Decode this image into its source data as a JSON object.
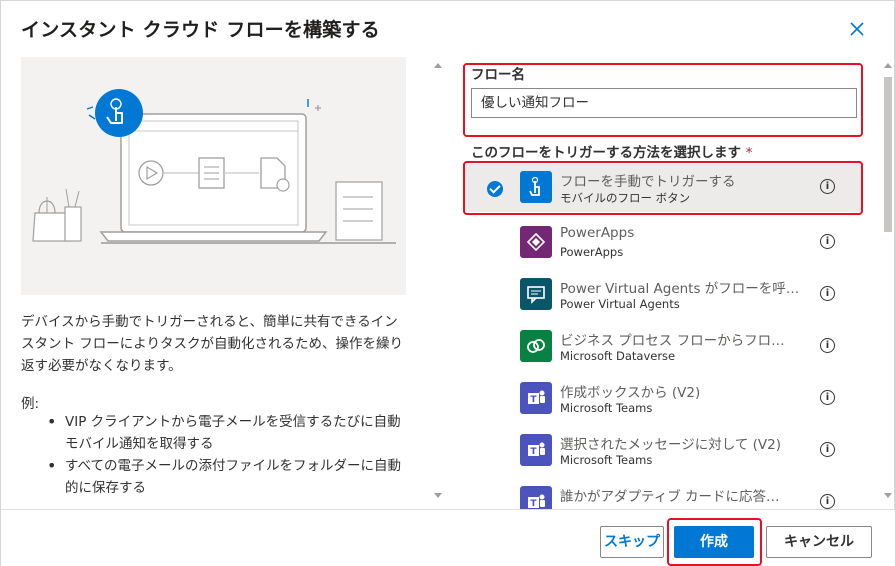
{
  "dialog": {
    "title": "インスタント クラウド フローを構築する",
    "close_icon": "close-icon"
  },
  "left": {
    "illustration_icon": "touch-icon",
    "description": "デバイスから手動でトリガーされると、簡単に共有できるインスタント フローによりタスクが自動化されるため、操作を繰り返す必要がなくなります。",
    "example_label": "例:",
    "examples": [
      "VIP クライアントから電子メールを受信するたびに自動モバイル通知を取得する",
      "すべての電子メールの添付ファイルをフォルダーに自動的に保存する"
    ]
  },
  "right": {
    "flow_name_label": "フロー名",
    "flow_name_value": "優しい通知フロー",
    "trigger_label": "このフローをトリガーする方法を選択します",
    "required_mark": "*",
    "triggers": [
      {
        "title": "フローを手動でトリガーする",
        "subtitle": "モバイルのフロー ボタン",
        "icon": "manual-trigger-icon",
        "color": "#0078d4",
        "selected": true
      },
      {
        "title": "PowerApps",
        "subtitle": "PowerApps",
        "icon": "powerapps-icon",
        "color": "#742774",
        "selected": false
      },
      {
        "title": "Power Virtual Agents がフローを呼…",
        "subtitle": "Power Virtual Agents",
        "icon": "virtual-agents-icon",
        "color": "#0b556a",
        "selected": false
      },
      {
        "title": "ビジネス プロセス フローからフロ…",
        "subtitle": "Microsoft Dataverse",
        "icon": "dataverse-icon",
        "color": "#088142",
        "selected": false
      },
      {
        "title": "作成ボックスから (V2)",
        "subtitle": "Microsoft Teams",
        "icon": "teams-icon",
        "color": "#4b53bc",
        "selected": false
      },
      {
        "title": "選択されたメッセージに対して (V2)",
        "subtitle": "Microsoft Teams",
        "icon": "teams-icon",
        "color": "#4b53bc",
        "selected": false
      },
      {
        "title": "誰かがアダプティブ カードに応答…",
        "subtitle": "",
        "icon": "teams-icon",
        "color": "#4b53bc",
        "selected": false
      }
    ],
    "info_glyph": "i"
  },
  "footer": {
    "skip_label": "スキップ",
    "create_label": "作成",
    "cancel_label": "キャンセル"
  }
}
